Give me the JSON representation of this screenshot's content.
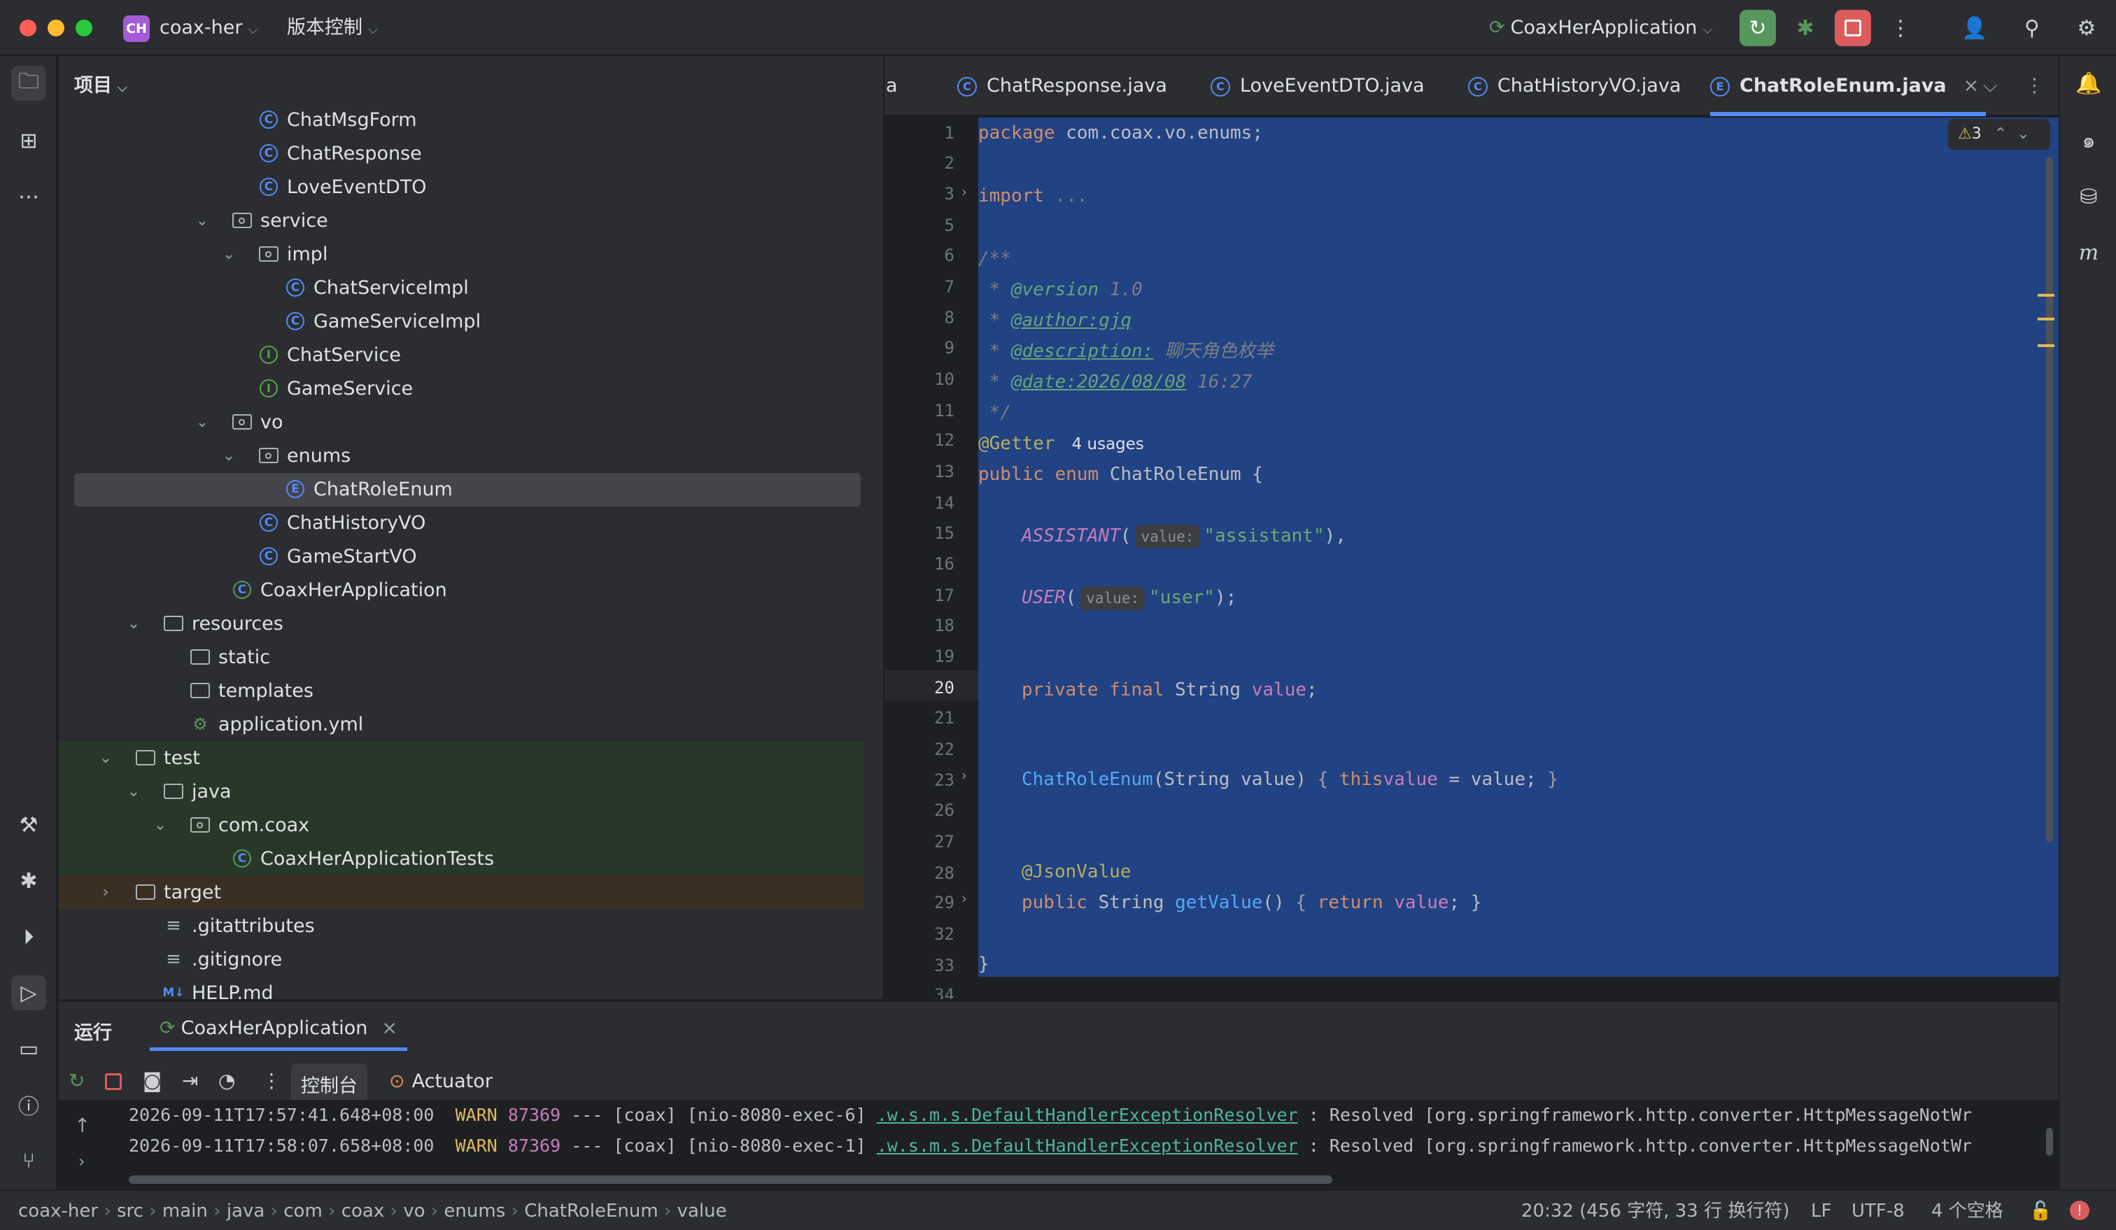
{
  "titlebar": {
    "project_badge": "CH",
    "project_name": "coax-her",
    "vcs": "版本控制",
    "run_config": "CoaxHerApplication"
  },
  "project_panel": {
    "title": "项目",
    "items": [
      {
        "label": "ChatMsgForm",
        "type": "class"
      },
      {
        "label": "ChatResponse",
        "type": "class"
      },
      {
        "label": "LoveEventDTO",
        "type": "class"
      },
      {
        "label": "service",
        "type": "package",
        "expanded": true
      },
      {
        "label": "impl",
        "type": "package",
        "expanded": true
      },
      {
        "label": "ChatServiceImpl",
        "type": "class"
      },
      {
        "label": "GameServiceImpl",
        "type": "class"
      },
      {
        "label": "ChatService",
        "type": "interface"
      },
      {
        "label": "GameService",
        "type": "interface"
      },
      {
        "label": "vo",
        "type": "package",
        "expanded": true
      },
      {
        "label": "enums",
        "type": "package",
        "expanded": true
      },
      {
        "label": "ChatRoleEnum",
        "type": "enum",
        "selected": true
      },
      {
        "label": "ChatHistoryVO",
        "type": "class"
      },
      {
        "label": "GameStartVO",
        "type": "class"
      },
      {
        "label": "CoaxHerApplication",
        "type": "spring"
      },
      {
        "label": "resources",
        "type": "folder",
        "expanded": true
      },
      {
        "label": "static",
        "type": "folder"
      },
      {
        "label": "templates",
        "type": "folder"
      },
      {
        "label": "application.yml",
        "type": "yml"
      },
      {
        "label": "test",
        "type": "folder",
        "expanded": true
      },
      {
        "label": "java",
        "type": "folder",
        "expanded": true
      },
      {
        "label": "com.coax",
        "type": "package",
        "expanded": true
      },
      {
        "label": "CoaxHerApplicationTests",
        "type": "spring"
      },
      {
        "label": "target",
        "type": "folder",
        "expanded": false
      },
      {
        "label": ".gitattributes",
        "type": "file"
      },
      {
        "label": ".gitignore",
        "type": "file"
      },
      {
        "label": "HELP.md",
        "type": "md"
      }
    ]
  },
  "tabs": [
    "a",
    "ChatResponse.java",
    "LoveEventDTO.java",
    "ChatHistoryVO.java",
    "ChatRoleEnum.java"
  ],
  "editor": {
    "warning_count": "3",
    "line_numbers": [
      "1",
      "2",
      "3",
      "5",
      "6",
      "7",
      "8",
      "9",
      "10",
      "11",
      "12",
      "13",
      "14",
      "15",
      "16",
      "17",
      "18",
      "19",
      "20",
      "21",
      "22",
      "23",
      "26",
      "27",
      "28",
      "29",
      "32",
      "33",
      "34"
    ],
    "lines": {
      "l1a": "package",
      "l1b": " com.coax.vo.enums;",
      "l3a": "import",
      "l3b": " ...",
      "l6": "/**",
      "l7a": " * ",
      "l7b": "@version",
      "l7c": " 1.0",
      "l8a": " * ",
      "l8b": "@author:gjq",
      "l9a": " * ",
      "l9b": "@description:",
      "l9c": " 聊天角色枚举",
      "l10a": " * ",
      "l10b": "@date:2026/08/08",
      "l10c": " 16:27",
      "l11": " */",
      "l12a": "@Getter",
      "l12b": "4 usages",
      "l13a": "public enum",
      "l13b": " ChatRoleEnum {",
      "l15a": "ASSISTANT",
      "l15b": "(",
      "l15h": "value:",
      "l15c": "\"assistant\"",
      "l15d": "),",
      "l17a": "USER",
      "l17b": "(",
      "l17h": "value:",
      "l17c": "\"user\"",
      "l17d": ");",
      "l20a": "private final",
      "l20b": " String ",
      "l20c": "value",
      ";": ";",
      "l23a": "ChatRoleEnum",
      "l23b": "(String value) ",
      "l23c": "{ ",
      "l23d": "this",
      ".": ".",
      "l23e": "value",
      "l23f": " = value; ",
      "l23g": "}",
      "l28": "@JsonValue",
      "l29a": "public",
      "l29b": " String ",
      "l29c": "getValue",
      "l29d": "() ",
      "l29e": "{ ",
      "l29f": "return ",
      "l29g": "value",
      "l29h": "; }",
      "l33": "}"
    }
  },
  "bottom": {
    "run_label": "运行",
    "run_tab": "CoaxHerApplication",
    "console_tab": "控制台",
    "actuator_tab": "Actuator",
    "logs": [
      {
        "ts": "2026-09-11T17:57:41.648+08:00",
        "level": "WARN",
        "pid": "87369",
        "mid": " --- [coax] [nio-8080-exec-6] ",
        "logger": ".w.s.m.s.DefaultHandlerExceptionResolver",
        "msg": " : Resolved [org.springframework.http.converter.HttpMessageNotWr"
      },
      {
        "ts": "2026-09-11T17:58:07.658+08:00",
        "level": "WARN",
        "pid": "87369",
        "mid": " --- [coax] [nio-8080-exec-1] ",
        "logger": ".w.s.m.s.DefaultHandlerExceptionResolver",
        "msg": " : Resolved [org.springframework.http.converter.HttpMessageNotWr"
      }
    ]
  },
  "status": {
    "breadcrumb": [
      "coax-her",
      "src",
      "main",
      "java",
      "com",
      "coax",
      "vo",
      "enums",
      "ChatRoleEnum",
      "value"
    ],
    "position": "20:32 (456 字符, 33 行 换行符)",
    "line_sep": "LF",
    "encoding": "UTF-8",
    "indent": "4 个空格"
  },
  "colors": {
    "accent": "#548af7",
    "selection": "#214283",
    "stop": "#db5c5c",
    "run": "#57965c"
  }
}
